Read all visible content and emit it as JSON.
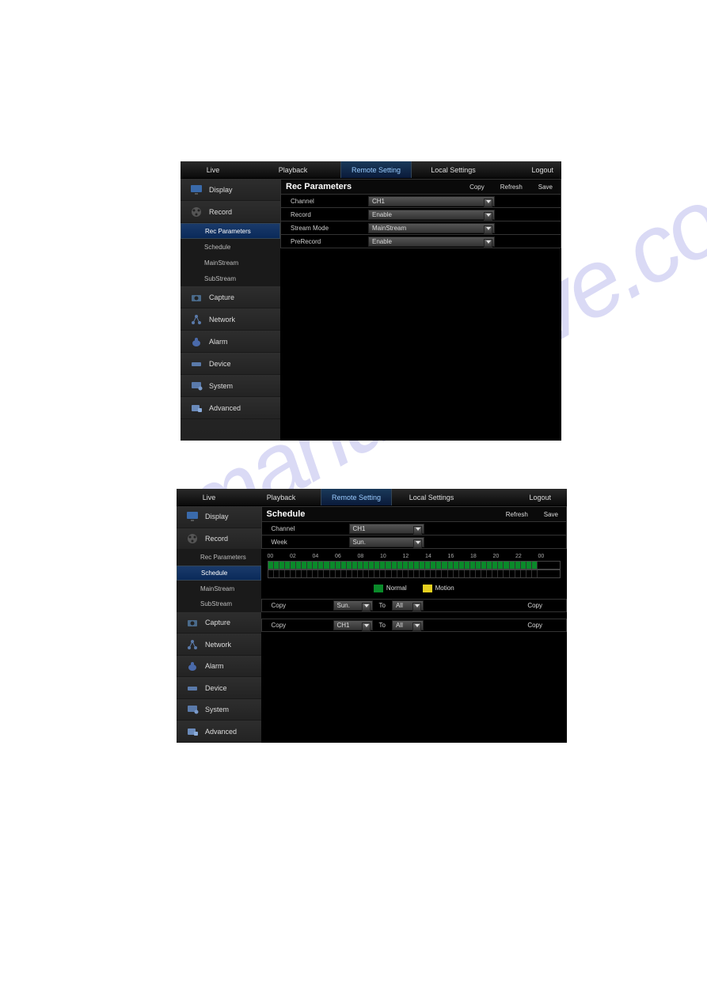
{
  "nav": {
    "live": "Live",
    "playback": "Playback",
    "remote": "Remote Setting",
    "local": "Local Settings",
    "logout": "Logout"
  },
  "side": {
    "display": "Display",
    "record": "Record",
    "capture": "Capture",
    "network": "Network",
    "alarm": "Alarm",
    "device": "Device",
    "system": "System",
    "advanced": "Advanced"
  },
  "sub": {
    "rec": "Rec Parameters",
    "sched": "Schedule",
    "main": "MainStream",
    "subs": "SubStream"
  },
  "panel1": {
    "title": "Rec Parameters",
    "copy": "Copy",
    "refresh": "Refresh",
    "save": "Save",
    "rows": [
      {
        "label": "Channel",
        "value": "CH1"
      },
      {
        "label": "Record",
        "value": "Enable"
      },
      {
        "label": "Stream Mode",
        "value": "MainStream"
      },
      {
        "label": "PreRecord",
        "value": "Enable"
      }
    ]
  },
  "panel2": {
    "title": "Schedule",
    "refresh": "Refresh",
    "save": "Save",
    "channel_lbl": "Channel",
    "channel_val": "CH1",
    "week_lbl": "Week",
    "week_val": "Sun.",
    "hours": [
      "00",
      "02",
      "04",
      "06",
      "08",
      "10",
      "12",
      "14",
      "16",
      "18",
      "20",
      "22",
      "00"
    ],
    "normal": "Normal",
    "motion": "Motion",
    "copy1": {
      "label": "Copy",
      "from": "Sun.",
      "to_lbl": "To",
      "to": "All",
      "btn": "Copy"
    },
    "copy2": {
      "label": "Copy",
      "from": "CH1",
      "to_lbl": "To",
      "to": "All",
      "btn": "Copy"
    }
  },
  "watermark": "manualshive.com"
}
